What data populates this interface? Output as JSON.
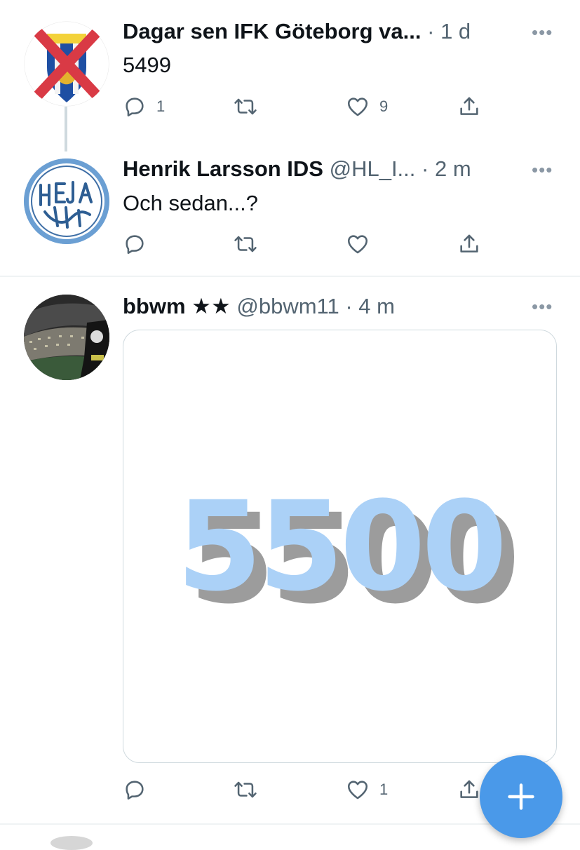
{
  "tweets": [
    {
      "name": "Dagar sen IFK Göteborg va...",
      "handle": "",
      "time": "1 d",
      "text": "5499",
      "avatar_icon": "ifk-crest-crossed-icon",
      "reply_count": "1",
      "retweet_count": "",
      "like_count": "9"
    },
    {
      "name": "Henrik Larsson IDS",
      "handle": "@HL_I...",
      "time": "2 m",
      "text": "Och sedan...?",
      "avatar_icon": "heja-logo-icon",
      "reply_count": "",
      "retweet_count": "",
      "like_count": ""
    },
    {
      "name": "bbwm ★★",
      "handle": "@bbwm11",
      "time": "4 m",
      "text": "",
      "image_text": "5500",
      "avatar_icon": "stadium-photo-icon",
      "reply_count": "",
      "retweet_count": "",
      "like_count": "1"
    }
  ],
  "separator": "·",
  "more_glyph": "•••",
  "colors": {
    "accent": "#4a99e9",
    "muted": "#536471",
    "image_number": "#abd1f7",
    "image_shadow": "#9c9c9c",
    "cross": "#d93a45"
  },
  "icons": [
    "reply-icon",
    "retweet-icon",
    "like-icon",
    "share-icon",
    "more-icon",
    "compose-plus-icon"
  ]
}
